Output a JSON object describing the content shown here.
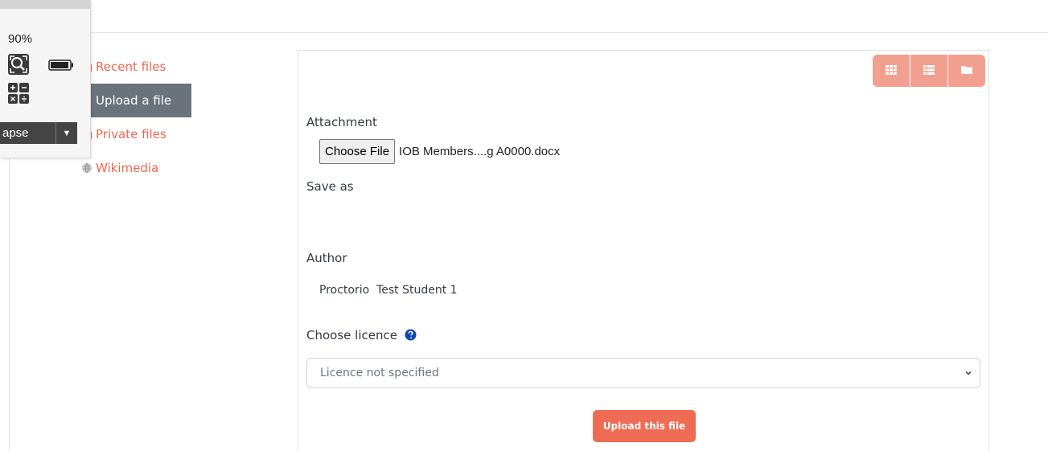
{
  "proctor_widget": {
    "zoom_level": "90%",
    "icons": [
      "zoom-icon",
      "battery-icon",
      "calculator-icon"
    ],
    "collapse_label": "apse"
  },
  "file_picker": {
    "nav_items": [
      {
        "label": "Recent files",
        "icon": "recent-files-icon",
        "active": false
      },
      {
        "label": "Upload a file",
        "icon": "upload-icon",
        "active": true
      },
      {
        "label": "Private files",
        "icon": "folder-icon",
        "active": false
      },
      {
        "label": "Wikimedia",
        "icon": "wikimedia-icon",
        "active": false
      }
    ],
    "view_buttons": [
      "grid-view-icon",
      "list-view-icon",
      "folder-view-icon"
    ]
  },
  "form": {
    "attachment_label": "Attachment",
    "choose_file_label": "Choose File",
    "file_name": "IOB Members....g A0000.docx",
    "save_as_label": "Save as",
    "save_as_value": "",
    "author_label": "Author",
    "author_value": "Proctorio  Test Student 1",
    "licence_label": "Choose licence",
    "licence_selected": "Licence not specified",
    "upload_button": "Upload this file"
  },
  "colors": {
    "accent": "#ef6c54",
    "link": "#f0674e",
    "view_buttons": "#f29f8f",
    "active_nav": "#6a737b"
  }
}
